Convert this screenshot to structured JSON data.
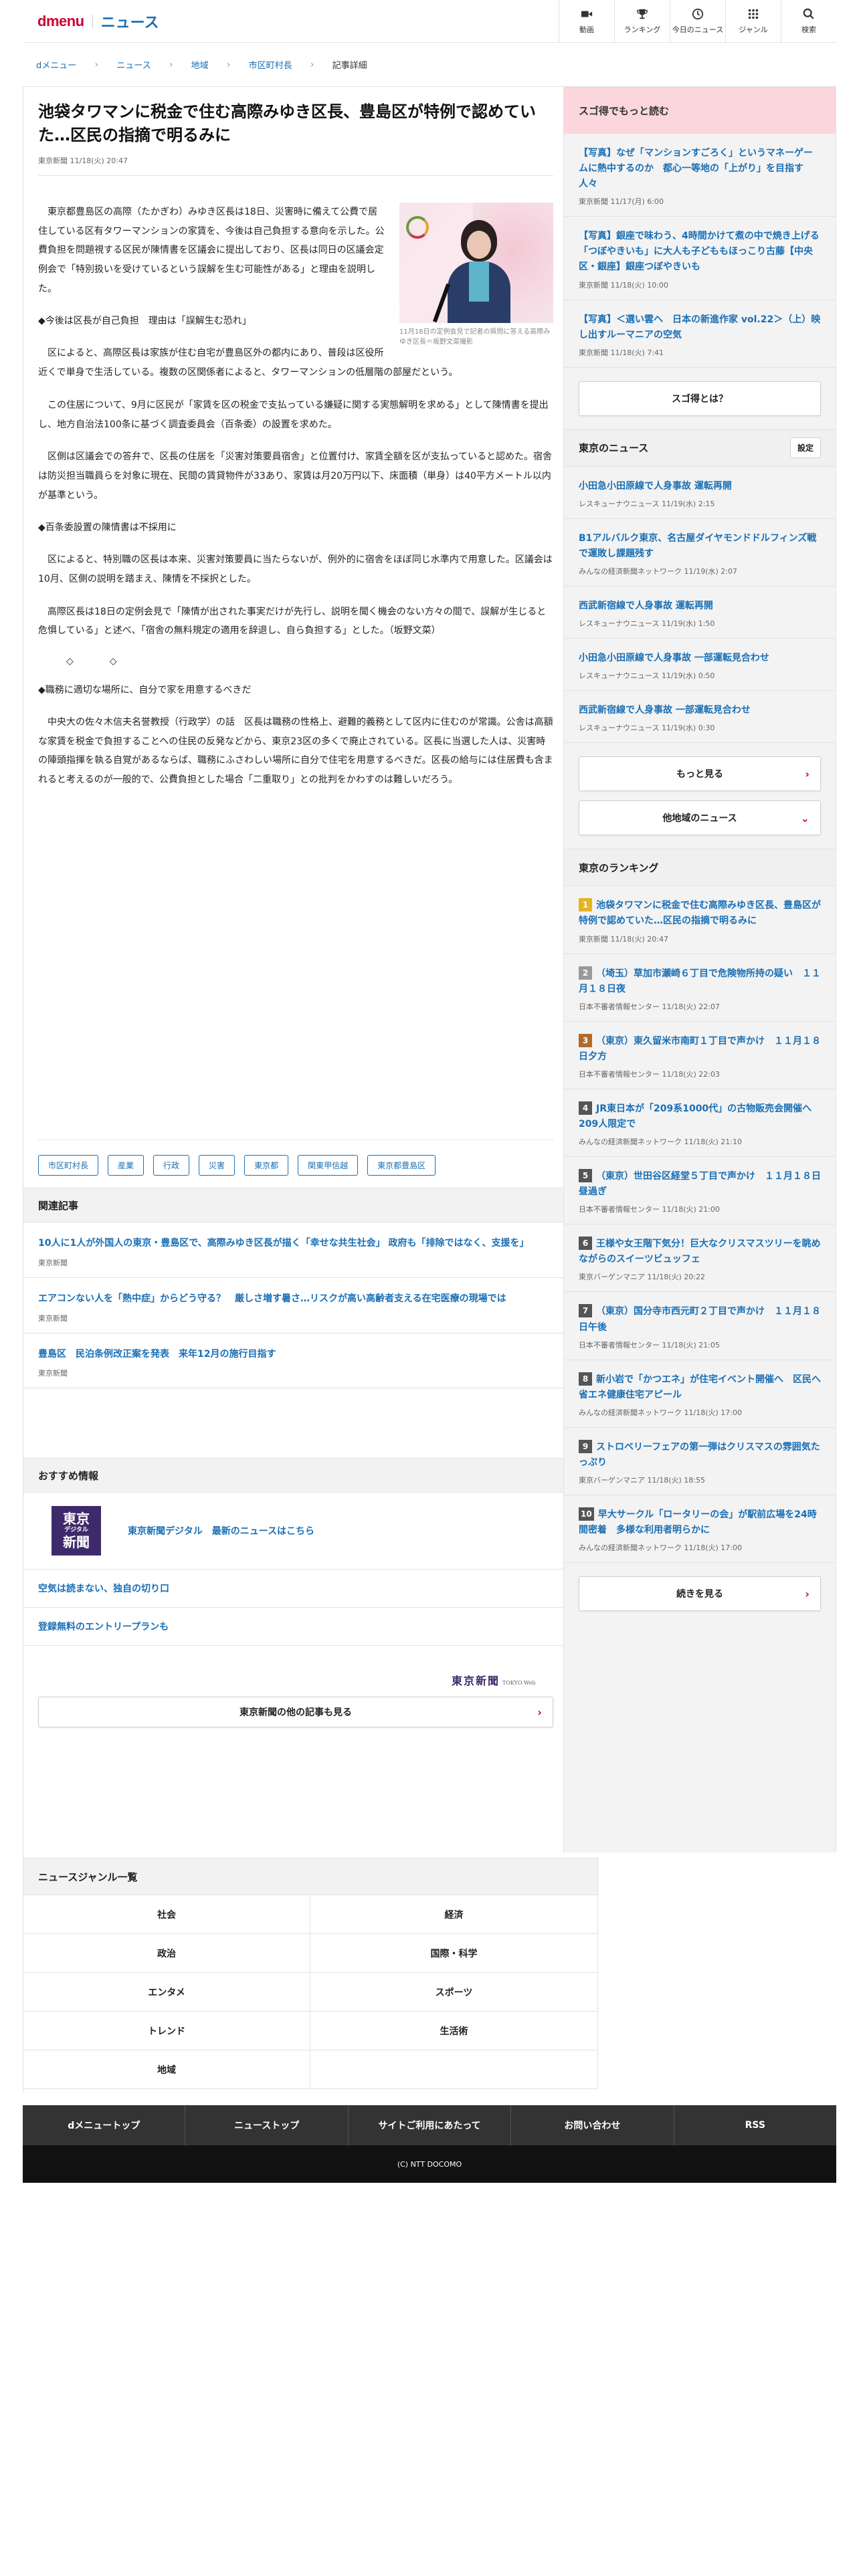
{
  "header": {
    "logo_brand": "dmenu",
    "logo_section": "ニュース",
    "nav": [
      {
        "label": "動画",
        "icon": "video-icon"
      },
      {
        "label": "ランキング",
        "icon": "trophy-icon"
      },
      {
        "label": "今日のニュース",
        "icon": "clock-icon"
      },
      {
        "label": "ジャンル",
        "icon": "grid-icon"
      },
      {
        "label": "検索",
        "icon": "search-icon"
      }
    ]
  },
  "breadcrumb": [
    "dメニュー",
    "ニュース",
    "地域",
    "市区町村長",
    "記事詳細"
  ],
  "article": {
    "title": "池袋タワマンに税金で住む高際みゆき区長、豊島区が特例で認めていた…区民の指摘で明るみに",
    "meta": "東京新聞 11/18(火) 20:47",
    "photo_caption": "11月18日の定例会見で記者の質問に答える高際みゆき区長＝坂野文菜撮影",
    "paragraphs": [
      "東京都豊島区の高際（たかぎわ）みゆき区長は18日、災害時に備えて公費で居住している区有タワーマンションの家賃を、今後は自己負担する意向を示した。公費負担を問題視する区民が陳情書を区議会に提出しており、区長は同日の区議会定例会で「特別扱いを受けているという誤解を生む可能性がある」と理由を説明した。",
      "◆今後は区長が自己負担　理由は「誤解生む恐れ」",
      "区によると、高際区長は家族が住む自宅が豊島区外の都内にあり、普段は区役所近くで単身で生活している。複数の区関係者によると、タワーマンションの低層階の部屋だという。",
      "この住居について、9月に区民が「家賃を区の税金で支払っている嫌疑に関する実態解明を求める」として陳情書を提出し、地方自治法100条に基づく調査委員会（百条委）の設置を求めた。",
      "区側は区議会での答弁で、区長の住居を「災害対策要員宿舎」と位置付け、家賃全額を区が支払っていると認めた。宿舎は防災担当職員らを対象に現在、民間の賃貸物件が33あり、家賃は月20万円以下、床面積（単身）は40平方メートル以内が基準という。",
      "◆百条委設置の陳情書は不採用に",
      "区によると、特別職の区長は本来、災害対策要員に当たらないが、例外的に宿舎をほぼ同じ水準内で用意した。区議会は10月、区側の説明を踏まえ、陳情を不採択とした。",
      "高際区長は18日の定例会見で「陳情が出された事実だけが先行し、説明を聞く機会のない方々の間で、誤解が生じると危惧している」と述べ、「宿舎の無料規定の適用を辞退し、自ら負担する」とした。（坂野文菜）",
      "◇　◇",
      "◆職務に適切な場所に、自分で家を用意するべきだ",
      "中央大の佐々木信夫名誉教授（行政学）の話　区長は職務の性格上、避難的義務として区内に住むのが常識。公舎は高額な家賃を税金で負担することへの住民の反発などから、東京23区の多くで廃止されている。区長に当選した人は、災害時の陣頭指揮を執る自覚があるならば、職務にふさわしい場所に自分で住宅を用意するべきだ。区長の給与には住居費も含まれると考えるのが一般的で、公費負担とした場合「二重取り」との批判をかわすのは難しいだろう。"
    ],
    "tags": [
      "市区町村長",
      "産業",
      "行政",
      "災害",
      "東京都",
      "関東甲信越",
      "東京都豊島区"
    ]
  },
  "related": {
    "heading": "関連記事",
    "items": [
      {
        "title": "10人に1人が外国人の東京・豊島区で、高際みゆき区長が描く「幸せな共生社会」 政府も「排除ではなく、支援を」",
        "source": "東京新聞"
      },
      {
        "title": "エアコンない人を「熱中症」からどう守る？　厳しさ増す暑さ…リスクが高い高齢者支える在宅医療の現場では",
        "source": "東京新聞"
      },
      {
        "title": "豊島区　民泊条例改正案を発表　来年12月の施行目指す",
        "source": "東京新聞"
      }
    ]
  },
  "recommend": {
    "heading": "おすすめ情報",
    "logo_lines": [
      "東京",
      "デジタル",
      "新聞"
    ],
    "items": [
      "東京新聞デジタル　最新のニュースはこちら",
      "空気は読まない、独自の切り口",
      "登録無料のエントリープランも"
    ],
    "source_logo": "東京新聞",
    "source_logo_sub": "TOKYO Web",
    "more_button": "東京新聞の他の記事も見る"
  },
  "sidebar": {
    "sugotoku": {
      "heading": "スゴ得でもっと読む",
      "items": [
        {
          "title": "【写真】なぜ「マンションすごろく」というマネーゲームに熱中するのか　都心一等地の「上がり」を目指す人々",
          "source": "東京新聞 11/17(月) 6:00"
        },
        {
          "title": "【写真】銀座で味わう、4時間かけて煮の中で焼き上げる「つぼやきいも」に大人も子どももほっこり古藤【中央区・銀座】銀座つぼやきいも",
          "source": "東京新聞 11/18(火) 10:00"
        },
        {
          "title": "【写真】＜選い雲へ　日本の新進作家 vol.22＞（上）映し出すルーマニアの空気",
          "source": "東京新聞 11/18(火) 7:41"
        }
      ],
      "button": "スゴ得とは？"
    },
    "tokyo_news": {
      "heading": "東京のニュース",
      "setting": "設定",
      "items": [
        {
          "title": "小田急小田原線で人身事故 運転再開",
          "source": "レスキューナウニュース 11/19(水) 2:15"
        },
        {
          "title": "B1アルバルク東京、名古屋ダイヤモンドドルフィンズ戦で運敗し課題残す",
          "source": "みんなの経済新聞ネットワーク 11/19(水) 2:07"
        },
        {
          "title": "西武新宿線で人身事故 運転再開",
          "source": "レスキューナウニュース 11/19(水) 1:50"
        },
        {
          "title": "小田急小田原線で人身事故 一部運転見合わせ",
          "source": "レスキューナウニュース 11/19(水) 0:50"
        },
        {
          "title": "西武新宿線で人身事故 一部運転見合わせ",
          "source": "レスキューナウニュース 11/19(水) 0:30"
        }
      ],
      "more_button": "もっと見る",
      "other_button": "他地域のニュース"
    },
    "ranking": {
      "heading": "東京のランキング",
      "items": [
        {
          "rank": "1",
          "color": "#e6b422",
          "title": "池袋タワマンに税金で住む高際みゆき区長、豊島区が特例で認めていた…区民の指摘で明るみに",
          "source": "東京新聞 11/18(火) 20:47"
        },
        {
          "rank": "2",
          "color": "#9a9a9a",
          "title": "（埼玉）草加市瀬崎６丁目で危険物所持の疑い　１１月１８日夜",
          "source": "日本不審者情報センター 11/18(火) 22:07"
        },
        {
          "rank": "3",
          "color": "#b26a2a",
          "title": "（東京）東久留米市南町１丁目で声かけ　１１月１８日夕方",
          "source": "日本不審者情報センター 11/18(火) 22:03"
        },
        {
          "rank": "4",
          "color": "#555555",
          "title": "JR東日本が「209系1000代」の古物販売会開催へ　209人限定で",
          "source": "みんなの経済新聞ネットワーク 11/18(火) 21:10"
        },
        {
          "rank": "5",
          "color": "#555555",
          "title": "（東京）世田谷区経堂５丁目で声かけ　１１月１８日昼過ぎ",
          "source": "日本不審者情報センター 11/18(火) 21:00"
        },
        {
          "rank": "6",
          "color": "#555555",
          "title": "王様や女王階下気分！巨大なクリスマスツリーを眺めながらのスイーツビュッフェ",
          "source": "東京バーゲンマニア 11/18(火) 20:22"
        },
        {
          "rank": "7",
          "color": "#555555",
          "title": "（東京）国分寺市西元町２丁目で声かけ　１１月１８日午後",
          "source": "日本不審者情報センター 11/18(火) 21:05"
        },
        {
          "rank": "8",
          "color": "#555555",
          "title": "新小岩で「かつエネ」が住宅イベント開催へ　区民へ省エネ健康住宅アピール",
          "source": "みんなの経済新聞ネットワーク 11/18(火) 17:00"
        },
        {
          "rank": "9",
          "color": "#555555",
          "title": "ストロベリーフェアの第一弾はクリスマスの雰囲気たっぷり",
          "source": "東京バーゲンマニア 11/18(火) 18:55"
        },
        {
          "rank": "10",
          "color": "#555555",
          "title": "早大サークル「ロータリーの会」が駅前広場を24時間密着　多様な利用者明らかに",
          "source": "みんなの経済新聞ネットワーク 11/18(火) 17:00"
        }
      ],
      "more_button": "続きを見る"
    }
  },
  "genres": {
    "heading": "ニュースジャンル一覧",
    "items": [
      "社会",
      "経済",
      "政治",
      "国際・科学",
      "エンタメ",
      "スポーツ",
      "トレンド",
      "生活術",
      "地域",
      ""
    ]
  },
  "footer": {
    "nav": [
      "dメニュートップ",
      "ニューストップ",
      "サイトご利用にあたって",
      "お問い合わせ",
      "RSS"
    ],
    "copyright": "(C) NTT DOCOMO"
  }
}
